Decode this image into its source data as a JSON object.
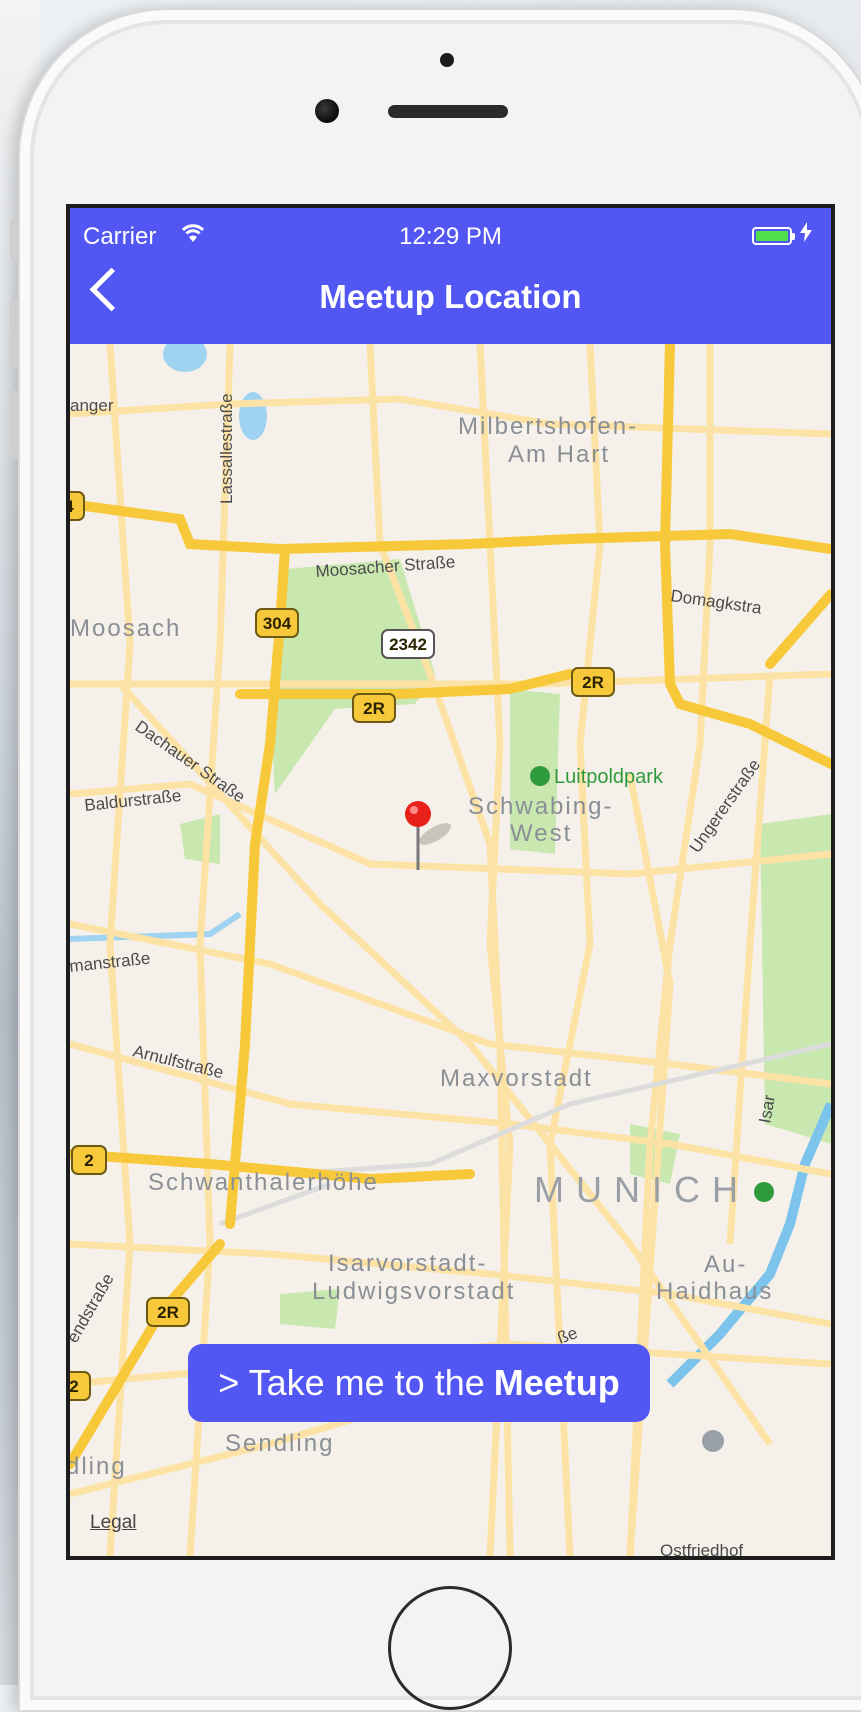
{
  "status_bar": {
    "carrier": "Carrier",
    "time": "12:29 PM",
    "wifi_icon": "wifi-icon",
    "battery_icon": "battery-icon"
  },
  "nav": {
    "title": "Meetup Location",
    "back_icon": "chevron-left-icon"
  },
  "map": {
    "districts": {
      "milbertshofen_1": "Milbertshofen-",
      "milbertshofen_2": "Am Hart",
      "moosach": "Moosach",
      "schwabing_1": "Schwabing-",
      "schwabing_2": "West",
      "maxvorstadt": "Maxvorstadt",
      "munich": "MUNICH",
      "schwanthalerhoehe": "Schwanthalerhöhe",
      "isarvorstadt_1": "Isarvorstadt-",
      "isarvorstadt_2": "Ludwigsvorstadt",
      "au_1": "Au-",
      "au_2": "Haidhaus",
      "sendling": "Sendling",
      "sendling_partial": "dling"
    },
    "streets": {
      "anger": "anger",
      "lassallestrasse": "Lassallestraße",
      "moosacher": "Moosacher Straße",
      "domagkstrasse": "Domagkstra",
      "dachauer": "Dachauer Straße",
      "baldurstrasse": "Baldurstraße",
      "ungerer": "Ungererstraße",
      "landsberger": "manstraße",
      "arnulf": "Arnulfstraße",
      "westend": "endstraße",
      "isar": "Isar",
      "be_fragment": "ße"
    },
    "poi": {
      "luitpoldpark": "Luitpoldpark",
      "ostfriedhof": "Ostfriedhof"
    },
    "shields": {
      "s304": "304",
      "s2342": "2342",
      "s2r_center": "2R",
      "s2r_right": "2R",
      "s2r_bottom": "2R",
      "s2_left": "2",
      "s2_bottom": "2",
      "s4_left": "4"
    },
    "legal": "Legal",
    "pin_icon": "map-pin-icon"
  },
  "cta": {
    "prefix": "> Take me to the",
    "emphasis": "Meetup"
  },
  "colors": {
    "accent": "#5256f2",
    "road_major": "#f7c93a",
    "road_minor": "#fde2a6",
    "park": "#c9e8b0",
    "map_bg": "#f5f1ea",
    "water": "#9fd3f1"
  }
}
